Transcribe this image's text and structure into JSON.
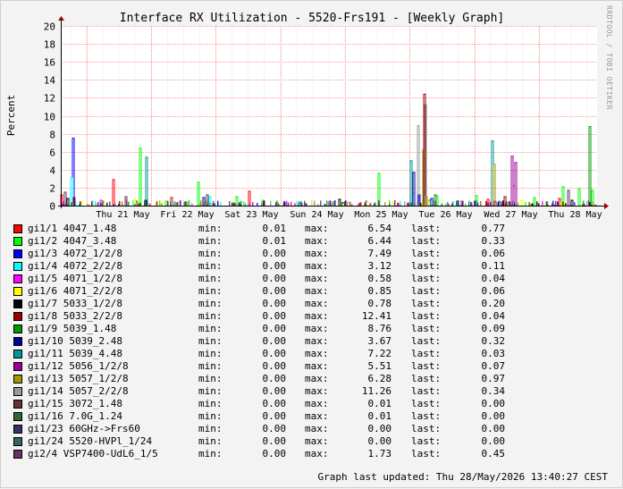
{
  "chart_data": {
    "type": "bar",
    "title": "Interface RX Utilization - 5520-Frs191 - [Weekly Graph]",
    "ylabel": "Percent",
    "xlabel": "",
    "ylim": [
      0,
      20
    ],
    "yticks": [
      0,
      2,
      4,
      6,
      8,
      10,
      12,
      14,
      16,
      18,
      20
    ],
    "xlim_days": [
      20.6,
      28.9
    ],
    "xticks": [
      {
        "label": "Thu 21 May",
        "day": 21
      },
      {
        "label": "Fri 22 May",
        "day": 22
      },
      {
        "label": "Sat 23 May",
        "day": 23
      },
      {
        "label": "Sun 24 May",
        "day": 24
      },
      {
        "label": "Mon 25 May",
        "day": 25
      },
      {
        "label": "Tue 26 May",
        "day": 26
      },
      {
        "label": "Wed 27 May",
        "day": 27
      },
      {
        "label": "Thu 28 May",
        "day": 28
      }
    ],
    "grid": true,
    "series": [
      {
        "name": "gi1/1 4047_1.48",
        "color": "#ff0000",
        "min": "0.01",
        "max": "6.54",
        "last": "0.77",
        "spikes": [
          [
            20.6,
            1.2
          ],
          [
            20.8,
            0.9
          ],
          [
            21.4,
            2.9
          ],
          [
            21.6,
            0.6
          ],
          [
            22.3,
            0.9
          ],
          [
            23.5,
            1.6
          ],
          [
            24.3,
            0.3
          ],
          [
            25.2,
            0.2
          ],
          [
            26.3,
            0.6
          ],
          [
            26.8,
            0.5
          ],
          [
            27.2,
            0.7
          ],
          [
            27.6,
            2.2
          ],
          [
            28.3,
            0.8
          ]
        ]
      },
      {
        "name": "gi1/2 4047_3.48",
        "color": "#00ff00",
        "min": "0.01",
        "max": "6.44",
        "last": "0.33",
        "spikes": [
          [
            21.8,
            6.4
          ],
          [
            22.2,
            0.5
          ],
          [
            22.7,
            2.6
          ],
          [
            23.3,
            1.0
          ],
          [
            23.7,
            0.6
          ],
          [
            25.5,
            3.6
          ],
          [
            26.4,
            1.1
          ],
          [
            27.0,
            1.1
          ],
          [
            27.9,
            0.9
          ],
          [
            28.35,
            2.1
          ],
          [
            28.6,
            1.9
          ],
          [
            28.8,
            1.7
          ]
        ]
      },
      {
        "name": "gi1/3 4072_1/2/8",
        "color": "#0000ff",
        "min": "0.00",
        "max": "7.49",
        "last": "0.06",
        "spikes": [
          [
            20.75,
            7.5
          ],
          [
            26.1,
            1.2
          ],
          [
            26.3,
            0.8
          ]
        ]
      },
      {
        "name": "gi1/4 4072_2/2/8",
        "color": "#00ffff",
        "min": "0.00",
        "max": "3.12",
        "last": "0.11",
        "spikes": [
          [
            20.75,
            3.1
          ],
          [
            22.9,
            1.0
          ],
          [
            26.05,
            1.4
          ]
        ]
      },
      {
        "name": "gi1/5 4071_1/2/8",
        "color": "#ff00ff",
        "min": "0.00",
        "max": "0.58",
        "last": "0.04",
        "spikes": [
          [
            21.2,
            0.6
          ],
          [
            22.5,
            0.4
          ],
          [
            27.3,
            0.5
          ]
        ]
      },
      {
        "name": "gi1/6 4071_2/2/8",
        "color": "#ffff00",
        "min": "0.00",
        "max": "0.85",
        "last": "0.06",
        "spikes": [
          [
            21.7,
            0.8
          ],
          [
            25.3,
            0.4
          ],
          [
            27.7,
            0.6
          ]
        ]
      },
      {
        "name": "gi1/7 5033_1/2/8",
        "color": "#000000",
        "min": "0.00",
        "max": "0.78",
        "last": "0.20",
        "spikes": [
          [
            20.7,
            0.8
          ],
          [
            21.9,
            0.6
          ],
          [
            24.9,
            0.7
          ],
          [
            26.25,
            0.7
          ],
          [
            28.5,
            0.6
          ]
        ]
      },
      {
        "name": "gi1/8 5033_2/2/8",
        "color": "#990000",
        "min": "0.00",
        "max": "12.41",
        "last": "0.04",
        "spikes": [
          [
            26.2,
            12.4
          ],
          [
            27.45,
            1.0
          ]
        ]
      },
      {
        "name": "gi1/9 5039_1.48",
        "color": "#009900",
        "min": "0.00",
        "max": "8.76",
        "last": "0.09",
        "spikes": [
          [
            28.75,
            8.8
          ],
          [
            26.35,
            1.2
          ]
        ]
      },
      {
        "name": "gi1/10 5039_2.48",
        "color": "#000099",
        "min": "0.00",
        "max": "3.67",
        "last": "0.32",
        "spikes": [
          [
            26.05,
            3.7
          ],
          [
            22.8,
            0.9
          ]
        ]
      },
      {
        "name": "gi1/11 5039_4.48",
        "color": "#009999",
        "min": "0.00",
        "max": "7.22",
        "last": "0.03",
        "spikes": [
          [
            21.9,
            5.4
          ],
          [
            26.0,
            5.0
          ],
          [
            27.25,
            7.2
          ]
        ]
      },
      {
        "name": "gi1/12 5056_1/2/8",
        "color": "#990099",
        "min": "0.00",
        "max": "5.51",
        "last": "0.07",
        "spikes": [
          [
            27.55,
            5.5
          ],
          [
            27.6,
            4.8
          ]
        ]
      },
      {
        "name": "gi1/13 5057_1/2/8",
        "color": "#999900",
        "min": "0.00",
        "max": "6.28",
        "last": "0.97",
        "spikes": [
          [
            26.2,
            6.3
          ],
          [
            27.3,
            4.6
          ],
          [
            26.25,
            1.0
          ]
        ]
      },
      {
        "name": "gi1/14 5057_2/2/8",
        "color": "#999999",
        "min": "0.00",
        "max": "11.26",
        "last": "0.34",
        "spikes": [
          [
            26.22,
            11.3
          ],
          [
            26.1,
            8.9
          ]
        ]
      },
      {
        "name": "gi1/15 3072_1.48",
        "color": "#663333",
        "min": "0.00",
        "max": "0.01",
        "last": "0.00",
        "spikes": []
      },
      {
        "name": "gi1/16 7.0G_1.24",
        "color": "#336633",
        "min": "0.00",
        "max": "0.01",
        "last": "0.00",
        "spikes": []
      },
      {
        "name": "gi1/23 60GHz->Frs60",
        "color": "#333366",
        "min": "0.00",
        "max": "0.00",
        "last": "0.00",
        "spikes": []
      },
      {
        "name": "gi1/24 5520-HVPl_1/24",
        "color": "#336666",
        "min": "0.00",
        "max": "0.00",
        "last": "0.00",
        "spikes": []
      },
      {
        "name": "gi2/4 VSP7400-UdL6_1/5",
        "color": "#663366",
        "min": "0.00",
        "max": "1.73",
        "last": "0.45",
        "spikes": [
          [
            20.65,
            1.5
          ],
          [
            21.6,
            1.0
          ],
          [
            22.85,
            1.2
          ],
          [
            28.45,
            1.7
          ]
        ]
      }
    ]
  },
  "legend_keys": {
    "min": "min:",
    "max": "max:",
    "last": "last:"
  },
  "footer": "Graph last updated: Thu 28/May/2026 13:40:27 CEST",
  "watermark": "RRDTOOL / TOBI OETIKER",
  "colors": {
    "canvas": "#ffffff",
    "background": "#f3f3f3",
    "major_grid": "#ff9999",
    "minor_grid": "#dddddd",
    "axis": "#000000"
  }
}
